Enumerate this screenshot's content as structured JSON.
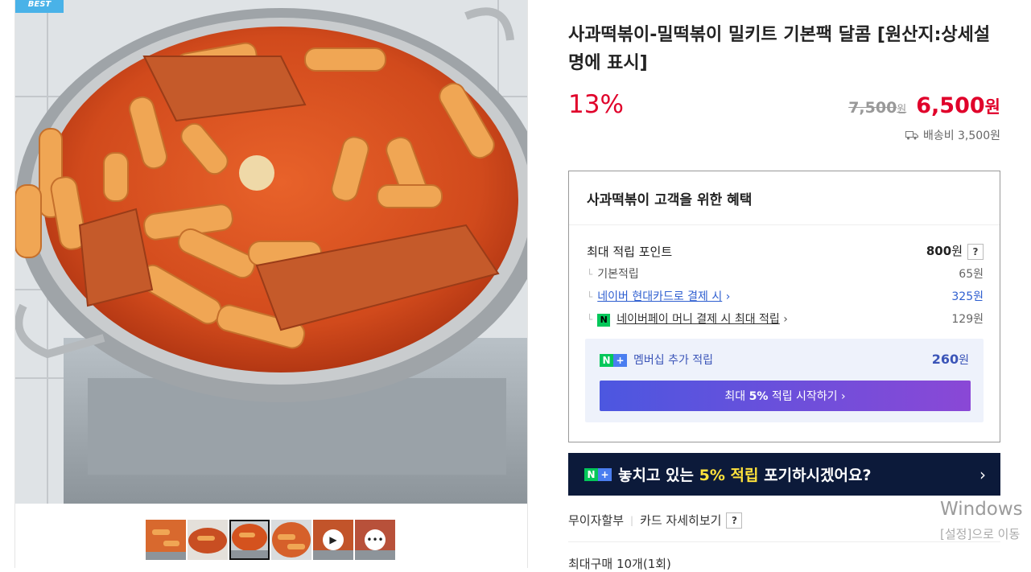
{
  "gallery": {
    "badge": "BEST",
    "thumbnails": [
      {
        "icon": "none"
      },
      {
        "icon": "none"
      },
      {
        "icon": "none",
        "selected": true
      },
      {
        "icon": "none"
      },
      {
        "icon": "play-icon"
      },
      {
        "icon": "chat-icon"
      }
    ]
  },
  "product": {
    "title": "사과떡볶이-밀떡볶이 밀키트 기본팩 달콤 [원산지:상세설명에 표시]",
    "discount_rate": "13%",
    "original_price": "7,500",
    "original_price_unit": "원",
    "sale_price": "6,500",
    "sale_price_unit": "원",
    "shipping": "배송비 3,500원"
  },
  "benefits": {
    "heading": "사과떡볶이 고객을 위한 혜택",
    "max_point_label": "최대 적립 포인트",
    "max_point_value": "800",
    "max_point_unit": "원",
    "help": "?",
    "rows": [
      {
        "label": "기본적립",
        "value": "65원"
      },
      {
        "label": "네이버 현대카드로 결제 시",
        "value": "325원"
      },
      {
        "label": "네이버페이 머니 결제 시 최대 적립",
        "value": "129원"
      }
    ],
    "membership": {
      "label": "멤버십 추가 적립",
      "value": "260",
      "unit": "원",
      "button_prefix": "최대",
      "button_highlight": "5%",
      "button_suffix": "적립 시작하기",
      "chevron": "›"
    }
  },
  "promo": {
    "text_before": "놓치고 있는",
    "highlight": "5% 적립",
    "text_after": "포기하시겠어요?",
    "chevron": "›"
  },
  "payment": {
    "installment": "무이자할부",
    "card_detail": "카드 자세히보기",
    "help": "?"
  },
  "purchase_limit": "최대구매 10개(1회)",
  "os_watermark": {
    "title": "Windows",
    "subtitle": "[설정]으로 이동"
  },
  "colors": {
    "price_red": "#e0002a",
    "link_blue": "#2f5fd0",
    "banner_bg": "#0c1a3a",
    "highlight_yellow": "#ffe23c",
    "naver_green": "#03c75a"
  }
}
